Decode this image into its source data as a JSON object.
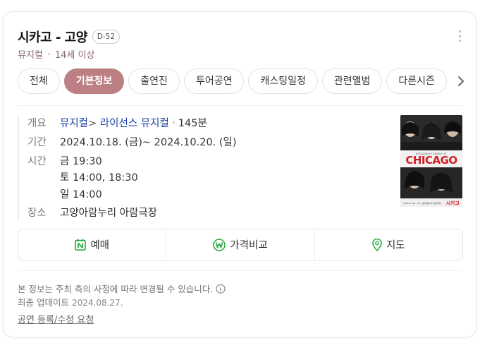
{
  "header": {
    "title": "시카고 - 고양",
    "dday": "D-52",
    "genre": "뮤지컬",
    "age": "14세 이상"
  },
  "tabs": [
    {
      "label": "전체",
      "active": false
    },
    {
      "label": "기본정보",
      "active": true
    },
    {
      "label": "출연진",
      "active": false
    },
    {
      "label": "투어공연",
      "active": false
    },
    {
      "label": "캐스팅일정",
      "active": false
    },
    {
      "label": "관련앨범",
      "active": false
    },
    {
      "label": "다른시즌",
      "active": false
    }
  ],
  "info": {
    "overview": {
      "label": "개요",
      "genre_link": "뮤지컬",
      "genre_arrow": ">",
      "subgenre_link": "라이선스 뮤지컬",
      "runtime": "145분"
    },
    "period": {
      "label": "기간",
      "value": "2024.10.18. (금)~ 2024.10.20. (일)"
    },
    "time": {
      "label": "시간",
      "lines": [
        "금 19:30",
        "토 14:00, 18:30",
        "일 14:00"
      ]
    },
    "venue": {
      "label": "장소",
      "value": "고양아람누리 아람극장"
    }
  },
  "poster": {
    "top_text": "BROADWAY'S SMASH HIT",
    "title": "CHICAGO",
    "city": "시카고",
    "dates_small": "2024.10.18 - 20 고양아람누리 아람극장"
  },
  "actions": {
    "reserve": "예매",
    "compare": "가격비교",
    "map": "지도"
  },
  "footer": {
    "notice": "본 정보는 주최 측의 사정에 따라 변경될 수 있습니다.",
    "updated_label": "최종 업데이트",
    "updated_date": "2024.08.27.",
    "report_link": "공연 등록/수정 요청"
  },
  "colors": {
    "accent": "#bb7f84",
    "link": "#1a3fa8",
    "reserve_icon": "#1fa83a",
    "compare_icon": "#1fa83a",
    "map_icon": "#1fa83a",
    "poster_title": "#d41f26"
  },
  "icons": {
    "more": "more-vertical-icon",
    "tab_next": "chevron-right-icon",
    "reserve": "naver-calendar-icon",
    "compare": "won-coin-icon",
    "map": "map-pin-icon",
    "notice": "info-circle-icon"
  }
}
